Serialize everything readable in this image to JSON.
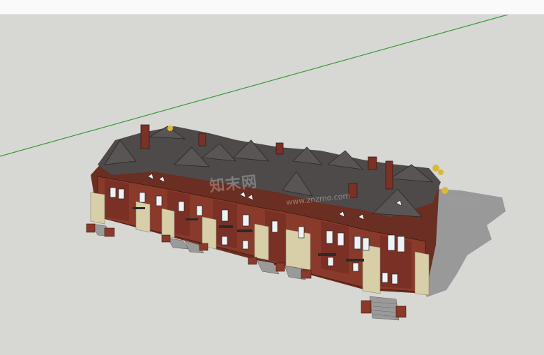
{
  "window": {
    "viewport_background": "#d7d7d3",
    "top_strip_color": "#fafafa"
  },
  "scene": {
    "model": "townhouse-row-3d-model",
    "green_axis_color": "#3a9a3a",
    "brick_color": "#8a3a2a",
    "roof_color": "#4e4a4a",
    "stone_color": "#d8cfa8",
    "shadow_color": "#8e8e8e"
  },
  "watermark": {
    "text": "知末网",
    "url": "www.znzmo.com"
  }
}
